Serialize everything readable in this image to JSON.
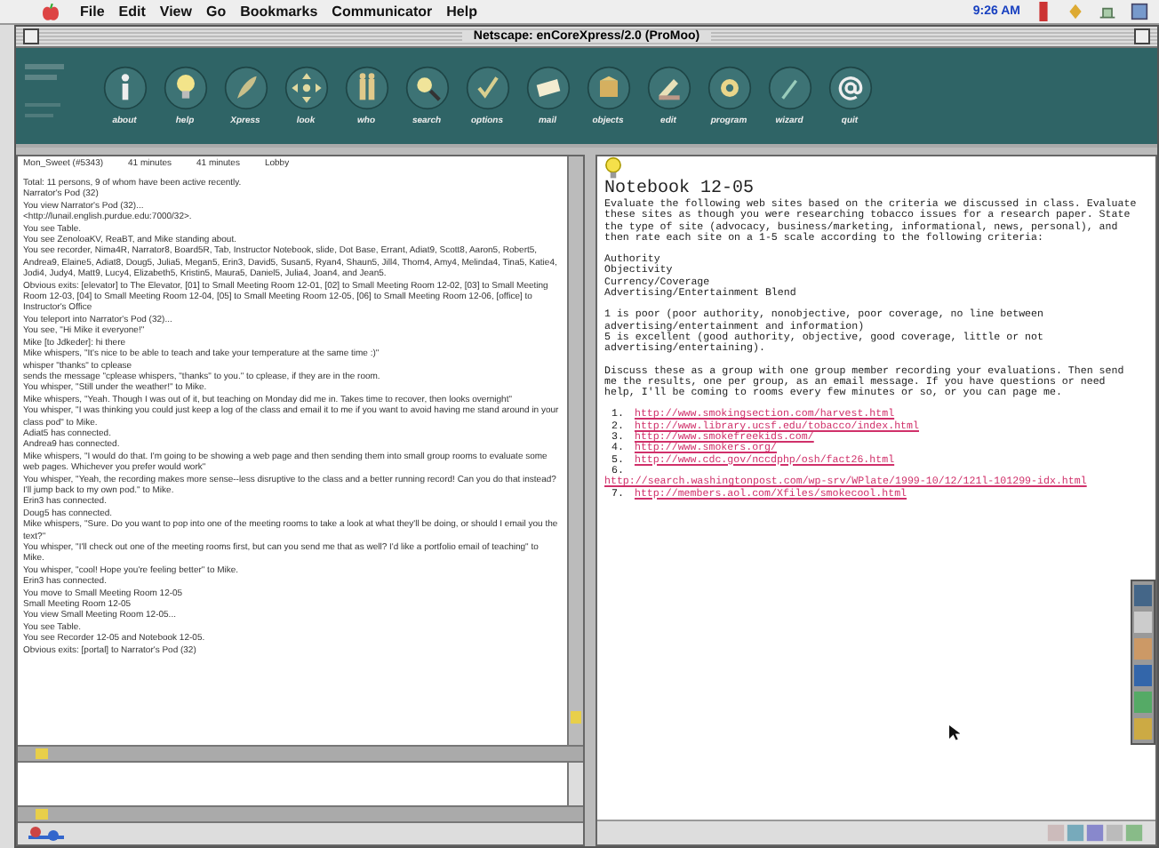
{
  "menu_bar": {
    "items": [
      "File",
      "Edit",
      "View",
      "Go",
      "Bookmarks",
      "Communicator",
      "Help"
    ],
    "clock": "9:26 AM"
  },
  "window": {
    "title": "Netscape: enCoreXpress/2.0 (ProMoo)"
  },
  "toolbar": {
    "buttons": [
      {
        "label": "about"
      },
      {
        "label": "help"
      },
      {
        "label": "Xpress"
      },
      {
        "label": "look"
      },
      {
        "label": "who"
      },
      {
        "label": "search"
      },
      {
        "label": "options"
      },
      {
        "label": "mail"
      },
      {
        "label": "objects"
      },
      {
        "label": "edit"
      },
      {
        "label": "program"
      },
      {
        "label": "wizard"
      },
      {
        "label": "quit"
      }
    ]
  },
  "chat": {
    "header": [
      "Mon_Sweet (#5343)",
      "41 minutes",
      "41 minutes",
      "Lobby"
    ],
    "log": [
      "Total: 11 persons, 9 of whom have been active recently.",
      "Narrator's Pod (32)",
      "You view Narrator's Pod (32)...",
      " <http://lunail.english.purdue.edu:7000/32>.",
      "You see Table.",
      "You see ZenoloaKV, ReaBT, and Mike standing about.",
      "You see recorder, Nima4R, Narrator8, Board5R, Tab, Instructor Notebook, slide, Dot Base, Errant, Adiat9, Scott8, Aaron5, Robert5, Andrea9, Elaine5, Adiat8, Doug5, Julia5, Megan5, Erin3, David5, Susan5, Ryan4, Shaun5, Jill4, Thom4, Amy4, Melinda4, Tina5, Katie4, Jodi4, Judy4, Matt9, Lucy4, Elizabeth5, Kristin5, Maura5, Daniel5, Julia4, Joan4, and Jean5.",
      "Obvious exits: [elevator] to The Elevator, [01] to Small Meeting Room 12-01, [02] to Small Meeting Room 12-02, [03] to Small Meeting Room 12-03, [04] to Small Meeting Room 12-04, [05] to Small Meeting Room 12-05, [06] to Small Meeting Room 12-06, [office] to Instructor's Office",
      "You teleport into Narrator's Pod (32)...",
      "You see, \"Hi Mike it everyone!\"",
      "Mike [to Jdkeder]: hi there",
      "Mike whispers, \"It's nice to be able to teach and take your temperature at the same time :)\"",
      "whisper \"thanks\" to cplease",
      "sends the message \"cplease whispers, \"thanks\" to you.\" to cplease, if they are in the room.",
      "You whisper, \"Still under the weather!\" to Mike.",
      "Mike whispers, \"Yeah. Though I was out of it, but teaching on Monday did me in. Takes time to recover, then looks overnight\"",
      "You whisper, \"I was thinking you could just keep a log of the class and email it to me if you want to avoid having me stand around in your class pod\" to Mike.",
      "Adiat5 has connected.",
      "Andrea9 has connected.",
      "Mike whispers, \"I would do that. I'm going to be showing a web page and then sending them into small group rooms to evaluate some web pages. Whichever you prefer would work\"",
      "You whisper, \"Yeah, the recording makes more sense--less disruptive to the class and a better running record! Can you do that instead? I'll jump back to my own pod.\" to Mike.",
      "Erin3 has connected.",
      "Doug5 has connected.",
      "Mike whispers, \"Sure. Do you want to pop into one of the meeting rooms to take a look at what they'll be doing, or should I email you the text?\"",
      "You whisper, \"I'll check out one of the meeting rooms first, but can you send me that as well? I'd like a portfolio email of teaching\" to Mike.",
      "You whisper, \"cool! Hope you're feeling better\" to Mike.",
      "Erin3 has connected.",
      "You move to Small Meeting Room 12-05",
      "Small Meeting Room 12-05",
      "You view Small Meeting Room 12-05...",
      "You see Table.",
      "You see Recorder 12-05 and Notebook 12-05.",
      "Obvious exits: [portal] to Narrator's Pod (32)"
    ]
  },
  "notebook": {
    "title": "Notebook 12-05",
    "intro": "Evaluate the following web sites based on the criteria we discussed in class. Evaluate these sites as though you were researching tobacco issues for a research paper. State the type of site (advocacy, business/marketing, informational, news, personal), and then rate each site on a 1-5 scale according to the following criteria:",
    "criteria": [
      "Authority",
      "Objectivity",
      "Currency/Coverage",
      "Advertising/Entertainment Blend"
    ],
    "scale": [
      "1 is poor (poor authority, nonobjective, poor coverage, no line between advertising/entertainment and information)",
      "5 is excellent (good authority, objective, good coverage, little or not advertising/entertaining)."
    ],
    "instructions": "Discuss these as a group with one group member recording your evaluations. Then send me the results, one per group, as an email message. If you have questions or need help, I'll be coming to rooms every few minutes or so, or you can page me.",
    "links": [
      {
        "number": "1.",
        "url": "http://www.smokingsection.com/harvest.html",
        "kind": "inline"
      },
      {
        "number": "2.",
        "url": "http://www.library.ucsf.edu/tobacco/index.html",
        "kind": "inline"
      },
      {
        "number": "3.",
        "url": "http://www.smokefreekids.com/",
        "kind": "inline"
      },
      {
        "number": "4.",
        "url": "http://www.smokers.org/",
        "kind": "inline"
      },
      {
        "number": "5.",
        "url": "http://www.cdc.gov/nccdphp/osh/fact26.html",
        "kind": "inline"
      },
      {
        "number": "6.",
        "url": "http://search.washingtonpost.com/wp-srv/WPlate/1999-10/12/121l-101299-idx.html",
        "kind": "wrapped"
      },
      {
        "number": "7.",
        "url": "http://members.aol.com/Xfiles/smokecool.html",
        "kind": "inline"
      }
    ]
  }
}
